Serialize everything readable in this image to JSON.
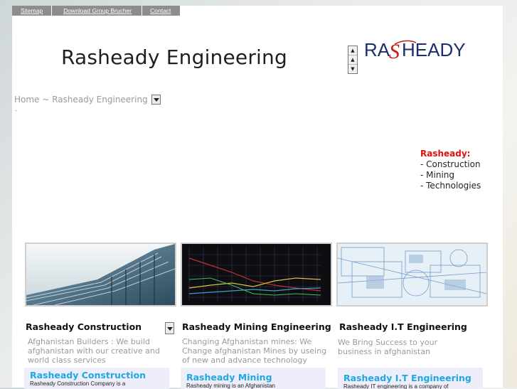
{
  "nav": {
    "sitemap": "Sitemap",
    "download": "Download Group Brucher",
    "contact": "Contact"
  },
  "site_title": "Rasheady Engineering",
  "logo": {
    "part1": "RA",
    "part2": "HEADY",
    "part3": "S"
  },
  "breadcrumb": "Home ~ Rasheady Engineering",
  "breadcrumb_dash": "-",
  "sidebox": {
    "head": "Rasheady:",
    "items": [
      "- Construction",
      "- Mining",
      "- Technologies"
    ]
  },
  "columns": [
    {
      "title": "Rasheady Construction Engineering",
      "desc": "Afghanistan Builders : We build afghanistan with our creative and world class services",
      "panel_title": "Rasheady Construction",
      "panel_text": "Rasheady Construction Company is a"
    },
    {
      "title": "Rasheady Mining Engineering",
      "desc": "Changing Afghanistan mines: We Change afghanistan Mines by useing of new and advance technology",
      "panel_title": "Rasheady Mining",
      "panel_text": "Rasheady mining is an Afghanistan"
    },
    {
      "title": "Rasheady I.T Engineering",
      "desc": "We Bring Success to your business in afghanistan",
      "panel_title": "Rasheady I.T Engineering",
      "panel_text": "Rasheady IT engineering is a company of"
    }
  ],
  "colors": {
    "nav_bg": "#8d8d8d",
    "accent_red": "#e21010",
    "panel_title": "#1ea7e0",
    "panel_bg": "#eeeefb"
  }
}
